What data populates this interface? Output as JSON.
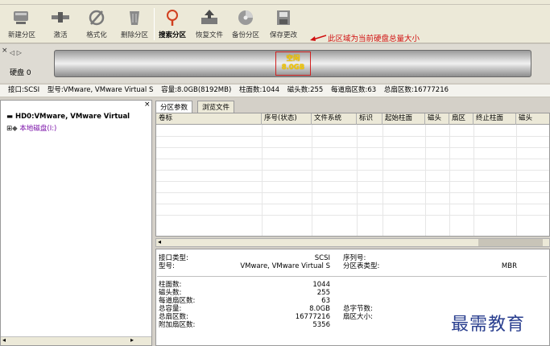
{
  "toolbar": {
    "buttons": [
      {
        "label": "新建分区",
        "icon": "new-partition-icon"
      },
      {
        "label": "激活",
        "icon": "activate-icon"
      },
      {
        "label": "格式化",
        "icon": "format-icon"
      },
      {
        "label": "删除分区",
        "icon": "delete-partition-icon"
      },
      {
        "label": "搜索分区",
        "icon": "search-partition-icon"
      },
      {
        "label": "恢复文件",
        "icon": "recover-file-icon"
      },
      {
        "label": "备份分区",
        "icon": "backup-partition-icon"
      },
      {
        "label": "保存更改",
        "icon": "save-changes-icon"
      }
    ],
    "active_index": 4
  },
  "annotation": {
    "text": "此区域为当前硬盘总量大小",
    "color": "#d01010"
  },
  "disk_panel": {
    "nav": "◁ ▷",
    "disk_label": "硬盘 0",
    "free_label": "空闲",
    "free_size": "8.0GB"
  },
  "info_line": {
    "interface": "接口:SCSI",
    "model": "型号:VMware, VMware Virtual S",
    "capacity": "容量:8.0GB(8192MB)",
    "cylinders": "柱面数:1044",
    "heads": "磁头数:255",
    "sectors_per_track": "每道扇区数:63",
    "total_sectors": "总扇区数:16777216"
  },
  "tree": {
    "disk_node": "HD0:VMware, VMware Virtual",
    "volume_node": "本地磁盘(I:)"
  },
  "tabs": [
    "分区参数",
    "浏览文件"
  ],
  "grid": {
    "columns": [
      "卷标",
      "序号(状态)",
      "文件系统",
      "标识",
      "起始柱面",
      "磁头",
      "扇区",
      "终止柱面",
      "磁头"
    ]
  },
  "details": {
    "interface_type_label": "接口类型:",
    "interface_type_value": "SCSI",
    "model_label": "型号:",
    "model_value": "VMware, VMware Virtual S",
    "serial_label": "序列号:",
    "partition_table_label": "分区表类型:",
    "partition_table_value": "MBR",
    "cylinders_label": "柱面数:",
    "cylinders_value": "1044",
    "heads_label": "磁头数:",
    "heads_value": "255",
    "spt_label": "每道扇区数:",
    "spt_value": "63",
    "total_capacity_label": "总容量:",
    "total_capacity_value": "8.0GB",
    "total_sectors_label": "总扇区数:",
    "total_sectors_value": "16777216",
    "extra_sectors_label": "附加扇区数:",
    "extra_sectors_value": "5356",
    "total_bytes_label": "总字节数:",
    "sector_size_label": "扇区大小:"
  },
  "watermark": "最需教育"
}
